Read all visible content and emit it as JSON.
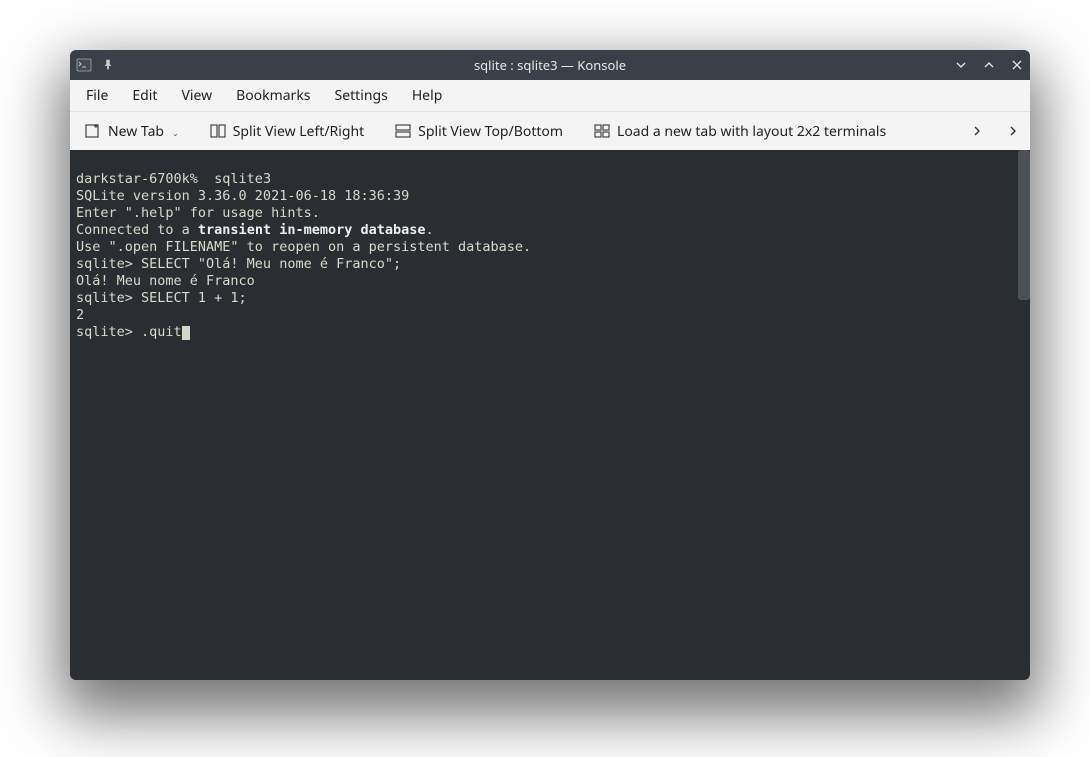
{
  "window": {
    "title": "sqlite : sqlite3 — Konsole"
  },
  "menu": {
    "file": "File",
    "edit": "Edit",
    "view": "View",
    "bookmarks": "Bookmarks",
    "settings": "Settings",
    "help": "Help"
  },
  "toolbar": {
    "new_tab": "New Tab",
    "split_lr": "Split View Left/Right",
    "split_tb": "Split View Top/Bottom",
    "load_layout": "Load a new tab with layout 2x2 terminals"
  },
  "terminal": {
    "line1_prompt": "darkstar-6700k%  ",
    "line1_cmd": "sqlite3",
    "line2": "SQLite version 3.36.0 2021-06-18 18:36:39",
    "line3": "Enter \".help\" for usage hints.",
    "line4a": "Connected to a ",
    "line4b": "transient in-memory database",
    "line4c": ".",
    "line5": "Use \".open FILENAME\" to reopen on a persistent database.",
    "line6": "sqlite> SELECT \"Olá! Meu nome é Franco\";",
    "line7": "Olá! Meu nome é Franco",
    "line8": "sqlite> SELECT 1 + 1;",
    "line9": "2",
    "line10": "sqlite> .quit"
  }
}
